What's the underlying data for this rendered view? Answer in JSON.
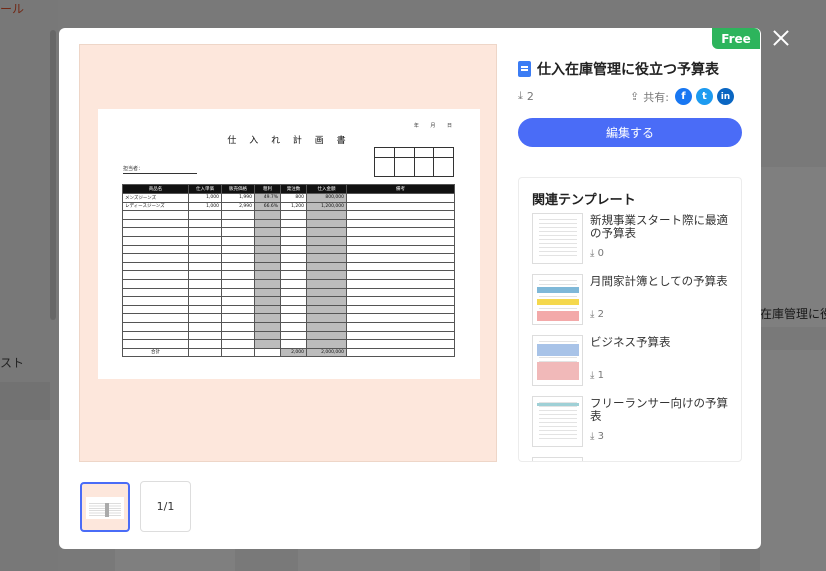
{
  "background": {
    "mail_text": "ール",
    "list_text": "スト",
    "right_card_title": "在庫管理に役"
  },
  "modal": {
    "badge": "Free",
    "title": "仕入在庫管理に役立つ予算表",
    "downloads": "2",
    "share_label": "共有:",
    "share_icons": [
      "facebook-icon",
      "twitter-icon",
      "linkedin-icon"
    ],
    "edit_button": "編集する",
    "page_count": "1/1",
    "colors": {
      "accent": "#4a6cf7",
      "free": "#2db45c",
      "facebook": "#1877f2",
      "twitter": "#1d9bf0",
      "linkedin": "#0a66c2"
    }
  },
  "sheet": {
    "date_text": "年 月 日",
    "title": "仕 入 れ 計 画 書",
    "person_label": "担当者：",
    "columns": [
      "商品名",
      "仕入単価",
      "販売価格",
      "粗利",
      "発注数",
      "仕入金額",
      "備考"
    ],
    "rows": [
      [
        "メンズジーンズ",
        "1,000",
        "1,990",
        "49.7%",
        "800",
        "800,000",
        ""
      ],
      [
        "レディースジーンズ",
        "1,000",
        "2,990",
        "66.6%",
        "1,200",
        "1,200,000",
        ""
      ]
    ],
    "total_label": "合計",
    "total_qty": "2,000",
    "total_amount": "2,000,000"
  },
  "related": {
    "title": "関連テンプレート",
    "items": [
      {
        "name": "新規事業スタート際に最適の予算表",
        "downloads": "0"
      },
      {
        "name": "月間家計簿としての予算表",
        "downloads": "2"
      },
      {
        "name": "ビジネス予算表",
        "downloads": "1"
      },
      {
        "name": "フリーランサー向けの予算表",
        "downloads": "3"
      }
    ]
  }
}
